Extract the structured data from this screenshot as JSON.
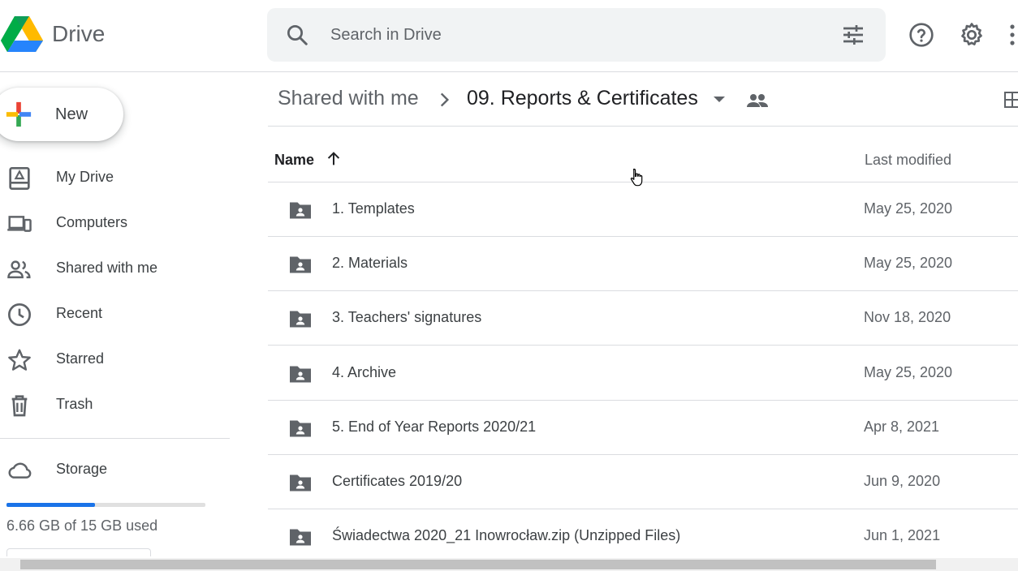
{
  "app": {
    "brand": "Drive"
  },
  "search": {
    "placeholder": "Search in Drive"
  },
  "sidebar": {
    "new_label": "New",
    "items": [
      {
        "label": "My Drive",
        "icon": "my-drive-icon"
      },
      {
        "label": "Computers",
        "icon": "computers-icon"
      },
      {
        "label": "Shared with me",
        "icon": "shared-icon"
      },
      {
        "label": "Recent",
        "icon": "clock-icon"
      },
      {
        "label": "Starred",
        "icon": "star-icon"
      },
      {
        "label": "Trash",
        "icon": "trash-icon"
      }
    ],
    "storage": {
      "label": "Storage",
      "used_text": "6.66 GB of 15 GB used",
      "used_fraction": 0.444
    }
  },
  "breadcrumb": {
    "root": "Shared with me",
    "current": "09. Reports & Certificates"
  },
  "table": {
    "col_name": "Name",
    "col_modified": "Last modified",
    "rows": [
      {
        "name": "1. Templates",
        "modified": "May 25, 2020"
      },
      {
        "name": "2. Materials",
        "modified": "May 25, 2020"
      },
      {
        "name": "3. Teachers' signatures",
        "modified": "Nov 18, 2020"
      },
      {
        "name": "4. Archive",
        "modified": "May 25, 2020"
      },
      {
        "name": "5. End of Year Reports 2020/21",
        "modified": "Apr 8, 2021"
      },
      {
        "name": "Certificates 2019/20",
        "modified": "Jun 9, 2020"
      },
      {
        "name": "Świadectwa 2020_21 Inowrocław.zip (Unzipped Files)",
        "modified": "Jun 1, 2021"
      }
    ]
  },
  "colors": {
    "accent": "#1a73e8",
    "icon": "#5f6368",
    "divider": "#dadce0"
  }
}
